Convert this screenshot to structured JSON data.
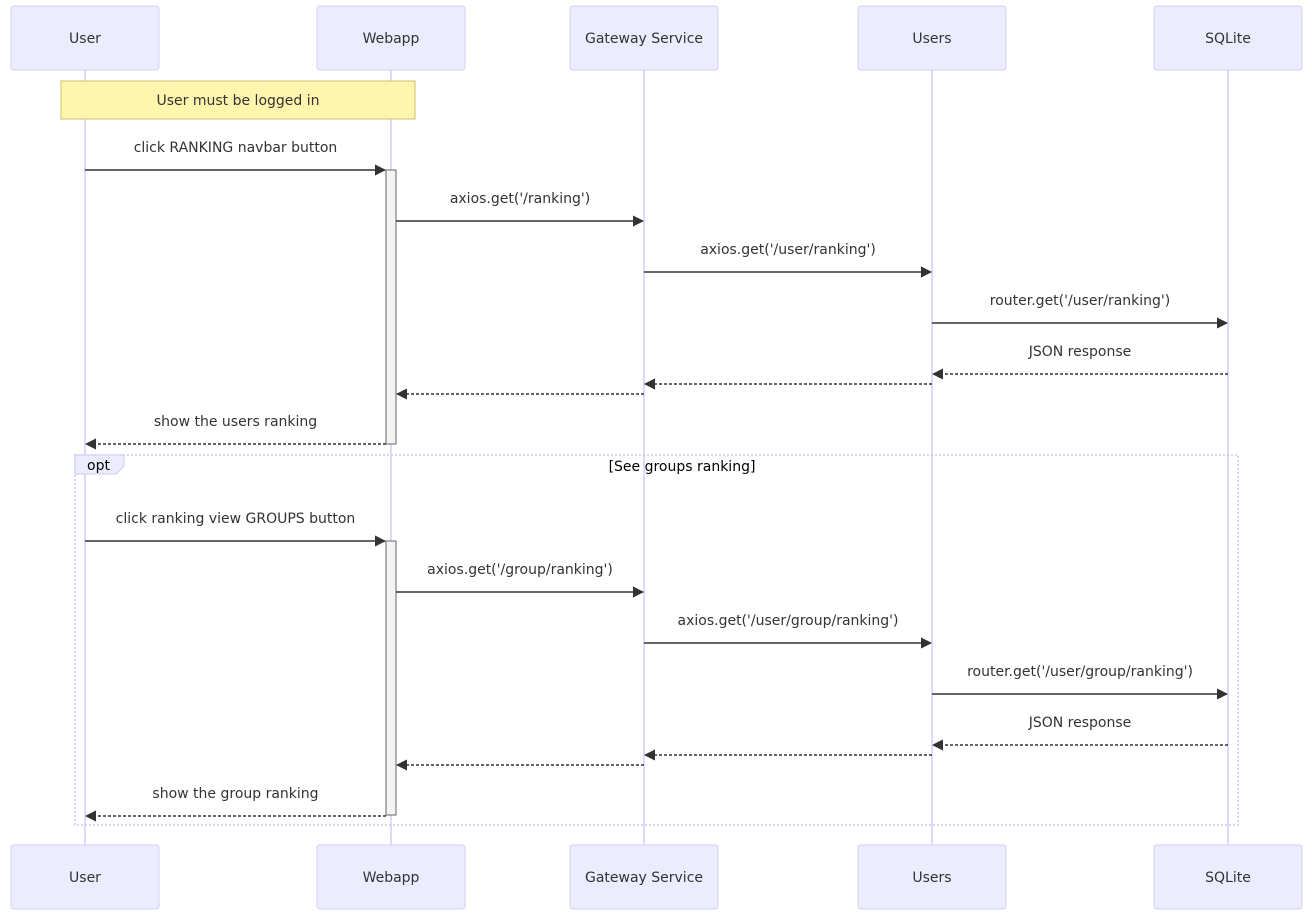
{
  "diagram_type": "sequence",
  "participants": [
    {
      "id": "user",
      "label": "User"
    },
    {
      "id": "webapp",
      "label": "Webapp"
    },
    {
      "id": "gateway",
      "label": "Gateway Service"
    },
    {
      "id": "users",
      "label": "Users"
    },
    {
      "id": "sqlite",
      "label": "SQLite"
    }
  ],
  "note": {
    "text": "User must be logged in",
    "over": [
      "user",
      "webapp"
    ]
  },
  "messages": [
    {
      "from": "user",
      "to": "webapp",
      "label": "click RANKING navbar button",
      "style": "solid"
    },
    {
      "from": "webapp",
      "to": "gateway",
      "label": "axios.get('/ranking')",
      "style": "solid"
    },
    {
      "from": "gateway",
      "to": "users",
      "label": "axios.get('/user/ranking')",
      "style": "solid"
    },
    {
      "from": "users",
      "to": "sqlite",
      "label": "router.get('/user/ranking')",
      "style": "solid"
    },
    {
      "from": "sqlite",
      "to": "users",
      "label": "JSON response",
      "style": "dotted"
    },
    {
      "from": "users",
      "to": "gateway",
      "label": "",
      "style": "dotted"
    },
    {
      "from": "gateway",
      "to": "webapp",
      "label": "",
      "style": "dotted"
    },
    {
      "from": "webapp",
      "to": "user",
      "label": "show the users ranking",
      "style": "dotted"
    },
    {
      "from": "user",
      "to": "webapp",
      "label": "click ranking view GROUPS button",
      "style": "solid"
    },
    {
      "from": "webapp",
      "to": "gateway",
      "label": "axios.get('/group/ranking')",
      "style": "solid"
    },
    {
      "from": "gateway",
      "to": "users",
      "label": "axios.get('/user/group/ranking')",
      "style": "solid"
    },
    {
      "from": "users",
      "to": "sqlite",
      "label": "router.get('/user/group/ranking')",
      "style": "solid"
    },
    {
      "from": "sqlite",
      "to": "users",
      "label": "JSON response",
      "style": "dotted"
    },
    {
      "from": "users",
      "to": "gateway",
      "label": "",
      "style": "dotted"
    },
    {
      "from": "gateway",
      "to": "webapp",
      "label": "",
      "style": "dotted"
    },
    {
      "from": "webapp",
      "to": "user",
      "label": "show the group ranking",
      "style": "dotted"
    }
  ],
  "fragments": [
    {
      "type": "opt",
      "label": "opt",
      "condition": "[See groups ranking]"
    }
  ],
  "colors": {
    "actor_fill": "#ececff",
    "actor_border": "#d4cff5",
    "note_fill": "#fff5ad",
    "note_border": "#c9c46a",
    "line": "#333333",
    "activation_fill": "#f4f4f4"
  }
}
